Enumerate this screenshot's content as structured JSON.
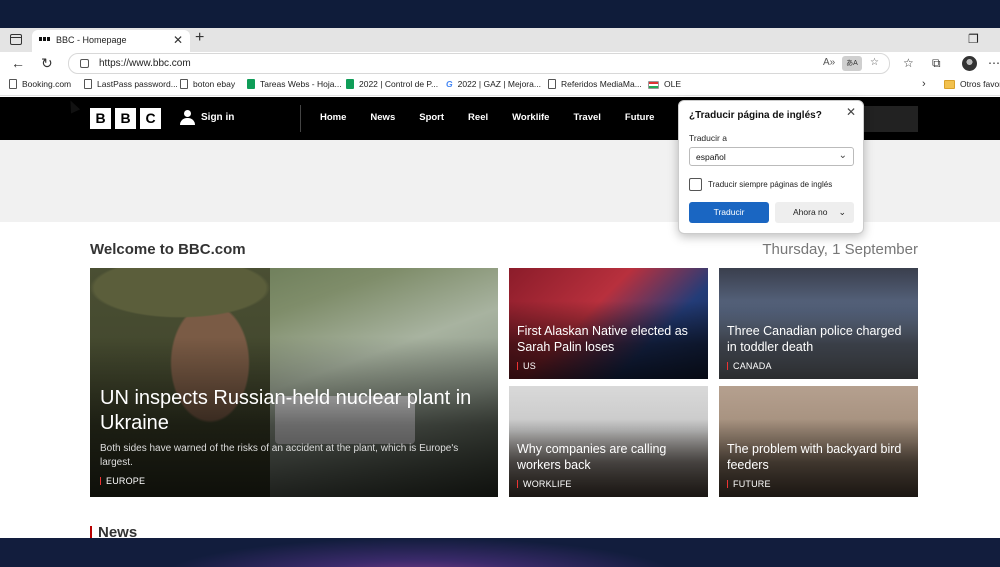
{
  "browser": {
    "tab": {
      "title": "BBC - Homepage",
      "close": "✕"
    },
    "new_tab": "+",
    "restore": "❐",
    "address": {
      "url": "https://www.bbc.com"
    },
    "bookmarks": [
      {
        "label": "Booking.com",
        "icon": "page-icon"
      },
      {
        "label": "LastPass password...",
        "icon": "page-icon"
      },
      {
        "label": "boton ebay",
        "icon": "page-icon"
      },
      {
        "label": "Tareas Webs - Hoja...",
        "icon": "sheets-icon"
      },
      {
        "label": "2022 | Control de P...",
        "icon": "sheets-icon"
      },
      {
        "label": "2022 | GAZ | Mejora...",
        "icon": "google-icon"
      },
      {
        "label": "Referidos MediaMa...",
        "icon": "page-icon"
      },
      {
        "label": "OLE",
        "icon": "flag-icon"
      },
      {
        "label": "Otros favor",
        "icon": "folder-icon"
      }
    ]
  },
  "bbc": {
    "logo": [
      "B",
      "B",
      "C"
    ],
    "sign_in": "Sign in",
    "nav": [
      "Home",
      "News",
      "Sport",
      "Reel",
      "Worklife",
      "Travel",
      "Future"
    ],
    "welcome": "Welcome to BBC.com",
    "date": "Thursday, 1 September",
    "main_story": {
      "headline": "UN inspects Russian-held nuclear plant in Ukraine",
      "summary": "Both sides have warned of the risks of an accident at the plant, which is Europe's largest.",
      "tag": "EUROPE"
    },
    "stories": [
      {
        "headline": "First Alaskan Native elected as Sarah Palin loses",
        "tag": "US"
      },
      {
        "headline": "Three Canadian police charged in toddler death",
        "tag": "CANADA"
      },
      {
        "headline": "Why companies are calling workers back",
        "tag": "WORKLIFE"
      },
      {
        "headline": "The problem with backyard bird feeders",
        "tag": "FUTURE"
      }
    ],
    "news_heading": "News"
  },
  "translate_popup": {
    "title": "¿Traducir página de inglés?",
    "translate_to_label": "Traducir a",
    "language": "español",
    "always_translate": "Traducir siempre páginas de inglés",
    "translate_button": "Traducir",
    "not_now_button": "Ahora no"
  },
  "colors": {
    "bbc_black": "#000000",
    "primary_button": "#1a66c2",
    "news_accent": "#b80000"
  }
}
